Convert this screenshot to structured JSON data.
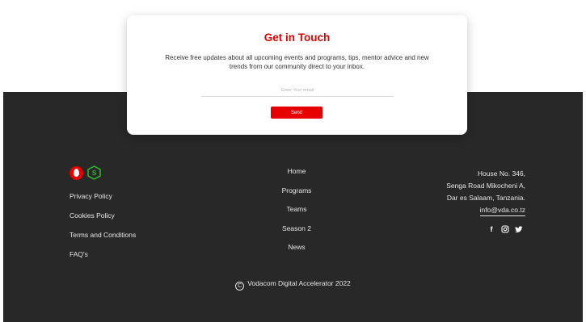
{
  "newsletter": {
    "title": "Get in Touch",
    "description": "Receive free updates about all upcoming events and programs, tips, mentor advice and new trends from our community direct to your inbox.",
    "email_placeholder": "Enter Your email",
    "send_label": "Send"
  },
  "footer": {
    "brand_icons": [
      "vodacom-logo-icon",
      "accelerator-hex-logo-icon"
    ],
    "legal_links": [
      "Privacy Policy",
      "Cookies Policy",
      "Terms and Conditions",
      "FAQ's"
    ],
    "nav_links": [
      "Home",
      "Programs",
      "Teams",
      "Season 2",
      "News"
    ],
    "address": {
      "line1": "House No. 346,",
      "line2": "Senga Road Mikocheni A,",
      "line3": "Dar es Salaam, Tanzania.",
      "email": "info@vda.co.tz"
    },
    "socials": [
      "facebook-icon",
      "instagram-icon",
      "twitter-icon"
    ],
    "copyright": "Vodacom Digital Accelerator 2022"
  },
  "colors": {
    "accent": "#e60000",
    "footer_bg": "#282828",
    "card_bg": "#ffffff"
  }
}
